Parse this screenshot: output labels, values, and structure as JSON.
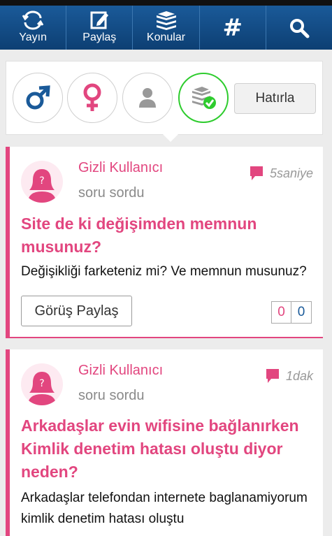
{
  "nav": {
    "items": [
      {
        "label": "Yayın",
        "icon": "refresh-icon"
      },
      {
        "label": "Paylaş",
        "icon": "edit-icon"
      },
      {
        "label": "Konular",
        "icon": "books-icon"
      },
      {
        "label": "#",
        "icon": "hashtag-icon"
      },
      {
        "label": "",
        "icon": "search-icon"
      }
    ]
  },
  "filter": {
    "options": [
      "male-icon",
      "female-icon",
      "person-icon",
      "books-check-icon"
    ],
    "remember_label": "Hatırla"
  },
  "posts": [
    {
      "user": "Gizli Kullanıcı",
      "action": "soru sordu",
      "time": "5saniye",
      "title": "Site de ki değişimden memnun musunuz?",
      "body": "Değişikliği farketeniz mi? Ve memnun musunuz?",
      "share_label": "Görüş Paylaş",
      "count_left": "0",
      "count_right": "0"
    },
    {
      "user": "Gizli Kullanıcı",
      "action": "soru sordu",
      "time": "1dak",
      "title": "Arkadaşlar evin wifisine bağlanırken Kimlik denetim hatası oluştu diyor neden?",
      "body": "Arkadaşlar telefondan internete baglanamiyorum kimlik denetim hatası oluştu"
    }
  ],
  "colors": {
    "nav": "#1a5a99",
    "accent": "#e2467f",
    "active": "#2ecc2e"
  }
}
